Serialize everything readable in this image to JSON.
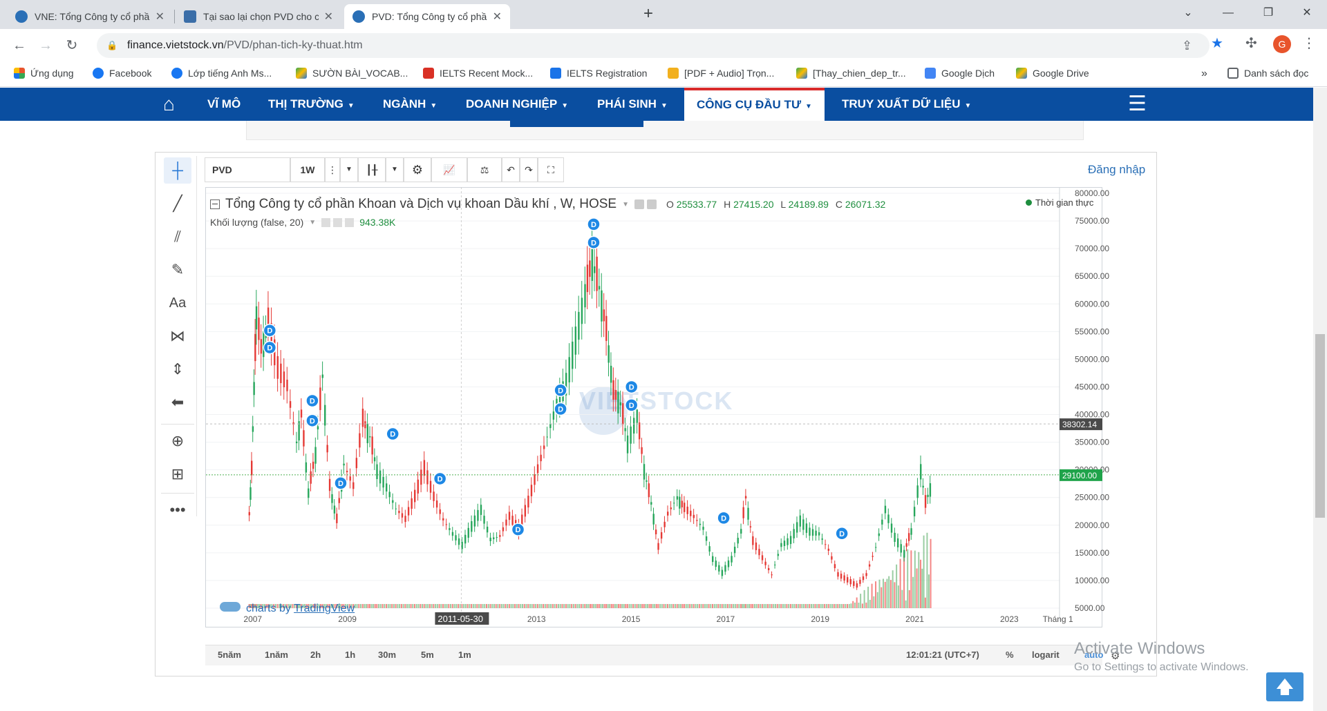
{
  "browser": {
    "tabs": [
      {
        "title": "VNE: Tổng Công ty cổ phần Xây dựng",
        "favicon_color": "#2a6fb6"
      },
      {
        "title": "Tại sao lại chọn PVD cho con sóng",
        "favicon_color": "#3b6ea8"
      },
      {
        "title": "PVD: Tổng Công ty cổ phần Khoan",
        "favicon_color": "#2a6fb6"
      }
    ],
    "active_tab": 2,
    "url_host": "finance.vietstock.vn",
    "url_path": "/PVD/phan-tich-ky-thuat.htm",
    "avatar_letter": "G",
    "bookmarks": [
      {
        "label": "Ứng dụng",
        "icon": "apps-grid-icon",
        "color": "#e8542c"
      },
      {
        "label": "Facebook",
        "icon": "facebook-icon",
        "color": "#1877f2"
      },
      {
        "label": "Lớp tiếng Anh Ms...",
        "icon": "facebook-icon",
        "color": "#1877f2"
      },
      {
        "label": "SƯỜN BÀI_VOCAB...",
        "icon": "google-drive-icon",
        "color": "#34a853"
      },
      {
        "label": "IELTS Recent Mock...",
        "icon": "ielts-icon",
        "color": "#d93025"
      },
      {
        "label": "IELTS Registration",
        "icon": "ielts-registration-icon",
        "color": "#1a73e8"
      },
      {
        "label": "[PDF + Audio] Trọn...",
        "icon": "pdf-icon",
        "color": "#f2b01e"
      },
      {
        "label": "[Thay_chien_dep_tr...",
        "icon": "google-drive-icon",
        "color": "#34a853"
      },
      {
        "label": "Google Dịch",
        "icon": "google-translate-icon",
        "color": "#4285f4"
      },
      {
        "label": "Google Drive",
        "icon": "google-drive-icon",
        "color": "#34a853"
      }
    ],
    "reading_list": "Danh sách đọc"
  },
  "site_nav": {
    "items": [
      {
        "label": "VĨ MÔ",
        "dropdown": false
      },
      {
        "label": "THỊ TRƯỜNG",
        "dropdown": true
      },
      {
        "label": "NGÀNH",
        "dropdown": true
      },
      {
        "label": "DOANH NGHIỆP",
        "dropdown": true
      },
      {
        "label": "PHÁI SINH",
        "dropdown": true
      },
      {
        "label": "CÔNG CỤ ĐẦU TƯ",
        "dropdown": true
      },
      {
        "label": "TRUY XUẤT DỮ LIỆU",
        "dropdown": true
      }
    ],
    "active_index": 5
  },
  "chart_widget": {
    "symbol": "PVD",
    "interval": "1W",
    "login_label": "Đăng nhập",
    "legend": {
      "title": "Tổng Công ty cổ phần Khoan và Dịch vụ khoan Dầu khí , W, HOSE",
      "o_label": "O",
      "o": "25533.77",
      "h_label": "H",
      "h": "27415.20",
      "l_label": "L",
      "l": "24189.89",
      "c_label": "C",
      "c": "26071.32",
      "volume_label": "Khối lượng (false, 20)",
      "volume_value": "943.38K",
      "realtime": "Thời gian thực"
    },
    "watermark": "VIETSTOCK",
    "tv_credit_prefix": "charts by",
    "tv_credit_link": "TradingView",
    "bottom_ranges": [
      "5năm",
      "1năm",
      "2h",
      "1h",
      "30m",
      "5m",
      "1m"
    ],
    "clock": "12:01:21 (UTC+7)",
    "percent": "%",
    "logarit": "logarit",
    "auto": "auto",
    "crosshair_date": "2011-05-30"
  },
  "chart_data": {
    "type": "candlestick",
    "title": "Tổng Công ty cổ phần Khoan và Dịch vụ khoan Dầu khí , W, HOSE",
    "y_axis_labels": [
      "80000.00",
      "75000.00",
      "70000.00",
      "65000.00",
      "60000.00",
      "55000.00",
      "50000.00",
      "45000.00",
      "40000.00",
      "35000.00",
      "30000.00",
      "25000.00",
      "20000.00",
      "15000.00",
      "10000.00",
      "5000.00"
    ],
    "ylim": [
      2000,
      80500
    ],
    "x_axis_labels": [
      "2007",
      "2009",
      "2011-05-30",
      "2013",
      "2015",
      "2017",
      "2019",
      "2021",
      "2023",
      "Tháng 1"
    ],
    "xlim": [
      2006.0,
      2023.95
    ],
    "crosshair_price_label": "38302.14",
    "current_price_label": "29100.00",
    "current_price": 29100,
    "crosshair_price": 38302.14,
    "price_path": [
      [
        2006.9,
        22000
      ],
      [
        2006.95,
        30000
      ],
      [
        2007.0,
        45000
      ],
      [
        2007.05,
        58000
      ],
      [
        2007.15,
        52000
      ],
      [
        2007.3,
        56000
      ],
      [
        2007.5,
        48000
      ],
      [
        2007.7,
        45000
      ],
      [
        2007.9,
        35000
      ],
      [
        2008.0,
        40000
      ],
      [
        2008.15,
        26000
      ],
      [
        2008.3,
        33000
      ],
      [
        2008.45,
        47000
      ],
      [
        2008.6,
        27000
      ],
      [
        2008.75,
        21000
      ],
      [
        2008.9,
        31000
      ],
      [
        2009.1,
        27000
      ],
      [
        2009.3,
        39000
      ],
      [
        2009.45,
        36000
      ],
      [
        2009.6,
        30000
      ],
      [
        2009.8,
        27000
      ],
      [
        2010.0,
        23000
      ],
      [
        2010.2,
        21000
      ],
      [
        2010.4,
        25000
      ],
      [
        2010.6,
        30000
      ],
      [
        2010.8,
        25000
      ],
      [
        2011.0,
        21000
      ],
      [
        2011.2,
        18500
      ],
      [
        2011.4,
        16500
      ],
      [
        2011.6,
        20000
      ],
      [
        2011.8,
        23000
      ],
      [
        2012.0,
        17500
      ],
      [
        2012.2,
        18000
      ],
      [
        2012.4,
        21500
      ],
      [
        2012.6,
        19000
      ],
      [
        2012.8,
        24000
      ],
      [
        2013.0,
        30000
      ],
      [
        2013.2,
        36000
      ],
      [
        2013.4,
        42000
      ],
      [
        2013.6,
        46000
      ],
      [
        2013.8,
        54000
      ],
      [
        2014.0,
        62000
      ],
      [
        2014.15,
        68000
      ],
      [
        2014.3,
        63000
      ],
      [
        2014.45,
        55000
      ],
      [
        2014.6,
        44000
      ],
      [
        2014.75,
        42000
      ],
      [
        2014.9,
        35000
      ],
      [
        2015.1,
        40000
      ],
      [
        2015.25,
        30000
      ],
      [
        2015.4,
        24000
      ],
      [
        2015.55,
        16000
      ],
      [
        2015.75,
        22000
      ],
      [
        2015.95,
        25000
      ],
      [
        2016.1,
        23000
      ],
      [
        2016.3,
        21500
      ],
      [
        2016.5,
        19500
      ],
      [
        2016.7,
        14000
      ],
      [
        2016.9,
        11500
      ],
      [
        2017.1,
        14000
      ],
      [
        2017.3,
        19000
      ],
      [
        2017.4,
        25000
      ],
      [
        2017.55,
        17000
      ],
      [
        2017.75,
        14000
      ],
      [
        2017.95,
        11000
      ],
      [
        2018.15,
        16500
      ],
      [
        2018.35,
        17500
      ],
      [
        2018.55,
        21000
      ],
      [
        2018.75,
        19000
      ],
      [
        2018.95,
        18500
      ],
      [
        2019.15,
        15500
      ],
      [
        2019.35,
        11000
      ],
      [
        2019.55,
        10000
      ],
      [
        2019.75,
        9000
      ],
      [
        2019.95,
        11000
      ],
      [
        2020.15,
        16000
      ],
      [
        2020.35,
        23000
      ],
      [
        2020.55,
        18000
      ],
      [
        2020.75,
        15000
      ],
      [
        2020.9,
        19000
      ],
      [
        2021.1,
        30000
      ],
      [
        2021.2,
        24000
      ],
      [
        2021.35,
        28000
      ]
    ],
    "dividend_markers": [
      [
        2007.35,
        55200
      ],
      [
        2007.35,
        52100
      ],
      [
        2008.25,
        42500
      ],
      [
        2008.25,
        38900
      ],
      [
        2008.85,
        27600
      ],
      [
        2009.95,
        36500
      ],
      [
        2010.95,
        28400
      ],
      [
        2012.6,
        19200
      ],
      [
        2013.5,
        44400
      ],
      [
        2013.5,
        41000
      ],
      [
        2014.2,
        74400
      ],
      [
        2014.2,
        71100
      ],
      [
        2015.0,
        45000
      ],
      [
        2015.0,
        41700
      ],
      [
        2016.95,
        21300
      ],
      [
        2019.45,
        18500
      ]
    ],
    "grid": true
  }
}
